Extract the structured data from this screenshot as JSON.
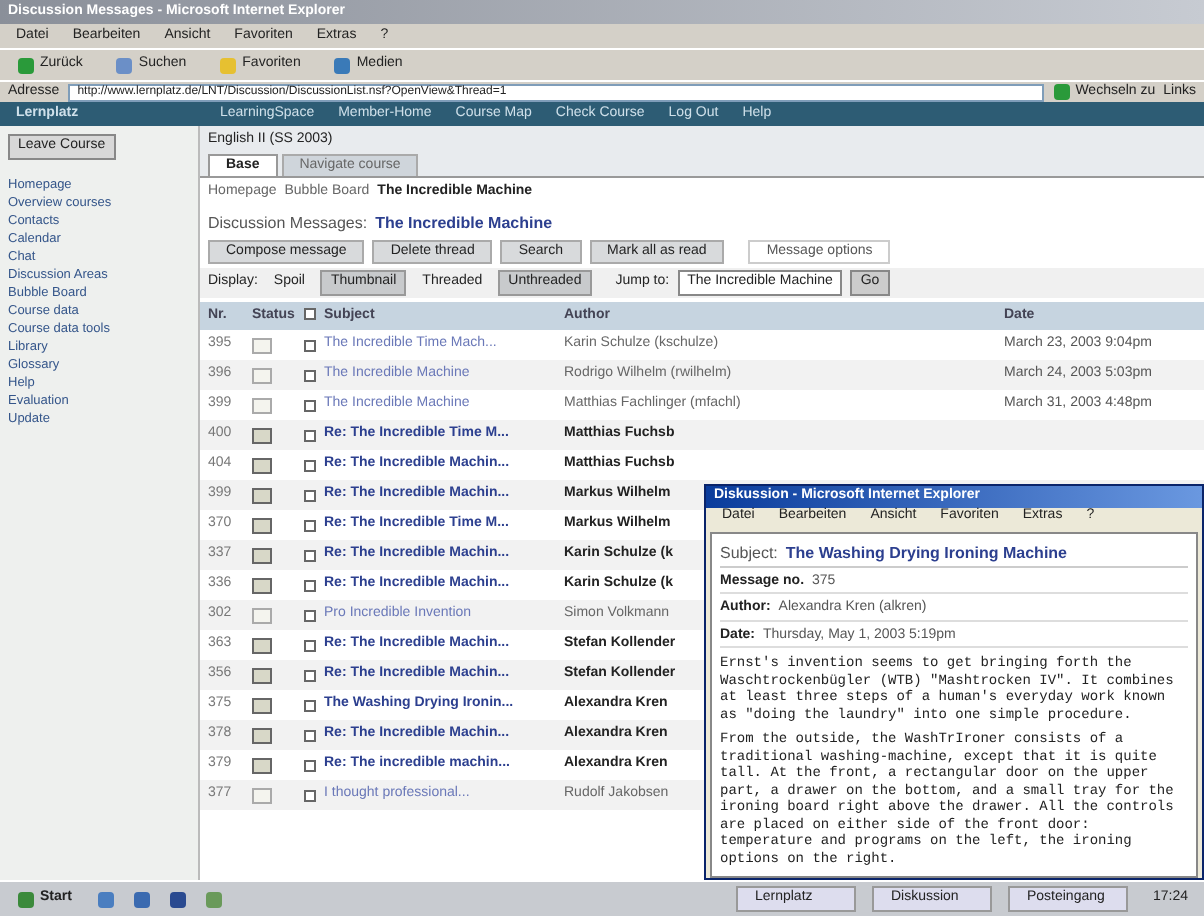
{
  "browser": {
    "title": "Discussion Messages - Microsoft Internet Explorer",
    "menu": [
      "Datei",
      "Bearbeiten",
      "Ansicht",
      "Favoriten",
      "Extras",
      "?"
    ],
    "toolbar": [
      "Zurück",
      "Suchen",
      "Favoriten",
      "Medien"
    ],
    "address_label": "Adresse",
    "address": "http://www.lernplatz.de/LNT/Discussion/DiscussionList.nsf?OpenView&Thread=1",
    "go": "Wechseln zu",
    "links": "Links"
  },
  "site_nav": {
    "logo": "Lernplatz",
    "items": [
      "LearningSpace",
      "Member-Home",
      "Course Map",
      "Check Course",
      "Log Out",
      "Help"
    ]
  },
  "sidebar": {
    "button": "Leave Course",
    "items": [
      "Homepage",
      "Overview courses",
      "Contacts",
      "Calendar",
      "Chat",
      "Discussion Areas",
      "Bubble Board",
      "Course data",
      "Course data tools",
      "Library",
      "Glossary",
      "Help",
      "Evaluation",
      "Update"
    ]
  },
  "course_title": "English II (SS 2003)",
  "tabs": [
    {
      "label": "Base",
      "selected": true
    },
    {
      "label": "Navigate course",
      "selected": false
    }
  ],
  "breadcrumb": [
    "Homepage",
    "Bubble Board",
    "The Incredible Machine"
  ],
  "heading": {
    "label": "Discussion Messages:",
    "topic": "The Incredible Machine"
  },
  "actions": [
    "Compose message",
    "Delete thread",
    "Search",
    "Mark all as read"
  ],
  "message_options": "Message options",
  "display": {
    "label": "Display:",
    "options": [
      {
        "label": "Spoil",
        "selected": false
      },
      {
        "label": "Thumbnail",
        "selected": true
      },
      {
        "label": "Threaded",
        "selected": false
      },
      {
        "label": "Unthreaded",
        "selected": true
      }
    ],
    "jump_label": "Jump to:",
    "jump_value": "The Incredible Machine",
    "go": "Go"
  },
  "table": {
    "columns": [
      "Nr.",
      "Status",
      "",
      "Subject",
      "Author",
      "Date"
    ],
    "select_all_checked": false,
    "rows": [
      {
        "nr": "395",
        "read": true,
        "subject": "The Incredible Time Mach...",
        "author": "Karin Schulze (kschulze)",
        "checked": false,
        "date": "March 23, 2003 9:04pm"
      },
      {
        "nr": "396",
        "read": true,
        "subject": "The Incredible Machine",
        "author": "Rodrigo Wilhelm (rwilhelm)",
        "checked": false,
        "date": "March 24, 2003 5:03pm"
      },
      {
        "nr": "399",
        "read": true,
        "subject": "The Incredible Machine",
        "author": "Matthias Fachlinger (mfachl)",
        "checked": false,
        "date": "March 31, 2003 4:48pm"
      },
      {
        "nr": "400",
        "read": false,
        "checked": false,
        "subject": "Re: The Incredible Time M...",
        "author": "Matthias Fuchsb"
      },
      {
        "nr": "404",
        "read": false,
        "checked": false,
        "subject": "Re: The Incredible Machin...",
        "author": "Matthias Fuchsb"
      },
      {
        "nr": "399",
        "read": false,
        "checked": false,
        "subject": "Re: The Incredible Machin...",
        "author": "Markus Wilhelm"
      },
      {
        "nr": "370",
        "read": false,
        "checked": false,
        "subject": "Re: The Incredible Time M...",
        "author": "Markus Wilhelm"
      },
      {
        "nr": "337",
        "read": false,
        "checked": false,
        "subject": "Re: The Incredible Machin...",
        "author": "Karin Schulze (k"
      },
      {
        "nr": "336",
        "read": false,
        "checked": false,
        "subject": "Re: The Incredible Machin...",
        "author": "Karin Schulze (k"
      },
      {
        "nr": "302",
        "read": true,
        "checked": false,
        "subject": "Pro Incredible Invention",
        "author": "Simon Volkmann"
      },
      {
        "nr": "363",
        "read": false,
        "checked": false,
        "subject": "Re: The Incredible Machin...",
        "author": "Stefan Kollender"
      },
      {
        "nr": "356",
        "read": false,
        "checked": false,
        "subject": "Re: The Incredible Machin...",
        "author": "Stefan Kollender"
      },
      {
        "nr": "375",
        "read": false,
        "checked": false,
        "subject": "The Washing Drying Ironin...",
        "author": "Alexandra Kren"
      },
      {
        "nr": "378",
        "read": false,
        "checked": false,
        "subject": "Re: The Incredible Machin...",
        "author": "Alexandra Kren"
      },
      {
        "nr": "379",
        "read": false,
        "checked": false,
        "subject": "Re: The incredible machin...",
        "author": "Alexandra Kren"
      },
      {
        "nr": "377",
        "read": true,
        "checked": false,
        "subject": "I thought professional...",
        "author": "Rudolf Jakobsen"
      }
    ]
  },
  "popup": {
    "title": "Diskussion - Microsoft Internet Explorer",
    "menu": [
      "Datei",
      "Bearbeiten",
      "Ansicht",
      "Favoriten",
      "Extras",
      "?"
    ],
    "subject_label": "Subject:",
    "subject": "The Washing Drying Ironing Machine",
    "fields": [
      {
        "label": "Message no.",
        "value": "375"
      },
      {
        "label": "Author:",
        "value": "Alexandra Kren (alkren)"
      },
      {
        "label": "Date:",
        "value": "Thursday, May 1, 2003 5:19pm"
      }
    ],
    "body": [
      "Ernst's invention seems to get bringing forth the Waschtrockenbügler (WTB) \"Mashtrocken IV\". It combines at least three steps of a human's everyday work known as \"doing the laundry\" into one simple procedure.",
      "From the outside, the WashTrIroner consists of a traditional washing-machine, except that it is quite tall. At the front, a rectangular door on the upper part, a drawer on the bottom, and a small tray for the ironing board right above the drawer. All the controls are placed on either side of the front door: temperature and programs on the left, the ironing options on the right."
    ]
  },
  "taskbar": {
    "start": "Start",
    "tasks": [
      "Lernplatz",
      "Diskussion",
      "Posteingang"
    ],
    "clock": "17:24"
  }
}
